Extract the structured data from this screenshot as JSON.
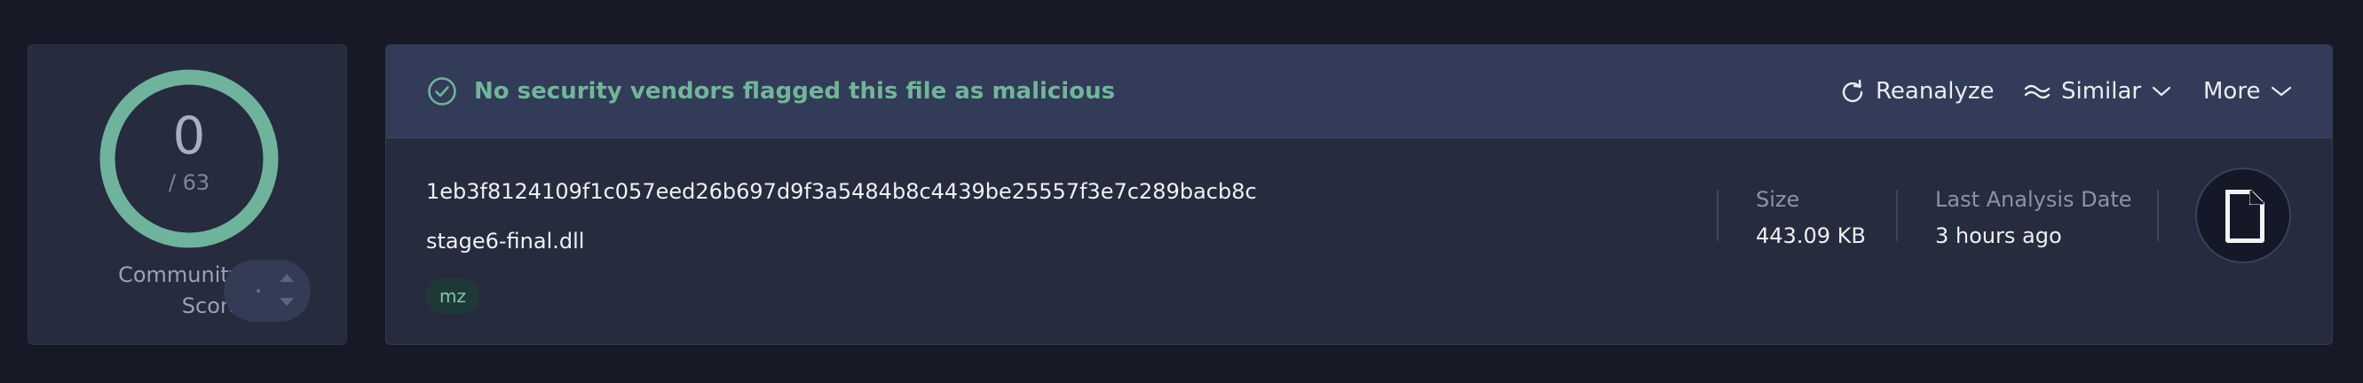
{
  "colors": {
    "accent": "#6fb39d",
    "background": "#171a26",
    "card": "#262b3d",
    "banner": "#323b58",
    "tag_bg": "#1f3a36"
  },
  "score": {
    "value": "0",
    "denominator": "/ 63",
    "detections_fraction": 0,
    "community_label_line1": "Community",
    "community_label_line2": "Score"
  },
  "banner": {
    "message": "No security vendors flagged this file as malicious",
    "icon": "check-circle-icon"
  },
  "actions": {
    "reanalyze": "Reanalyze",
    "similar": "Similar",
    "more": "More"
  },
  "file": {
    "hash": "1eb3f8124109f1c057eed26b697d9f3a5484b8c4439be25557f3e7c289bacb8c",
    "name": "stage6-final.dll",
    "tags": [
      "mz"
    ],
    "size_label": "Size",
    "size_value": "443.09 KB",
    "date_label": "Last Analysis Date",
    "date_value": "3 hours ago",
    "type_icon": "file-icon"
  }
}
